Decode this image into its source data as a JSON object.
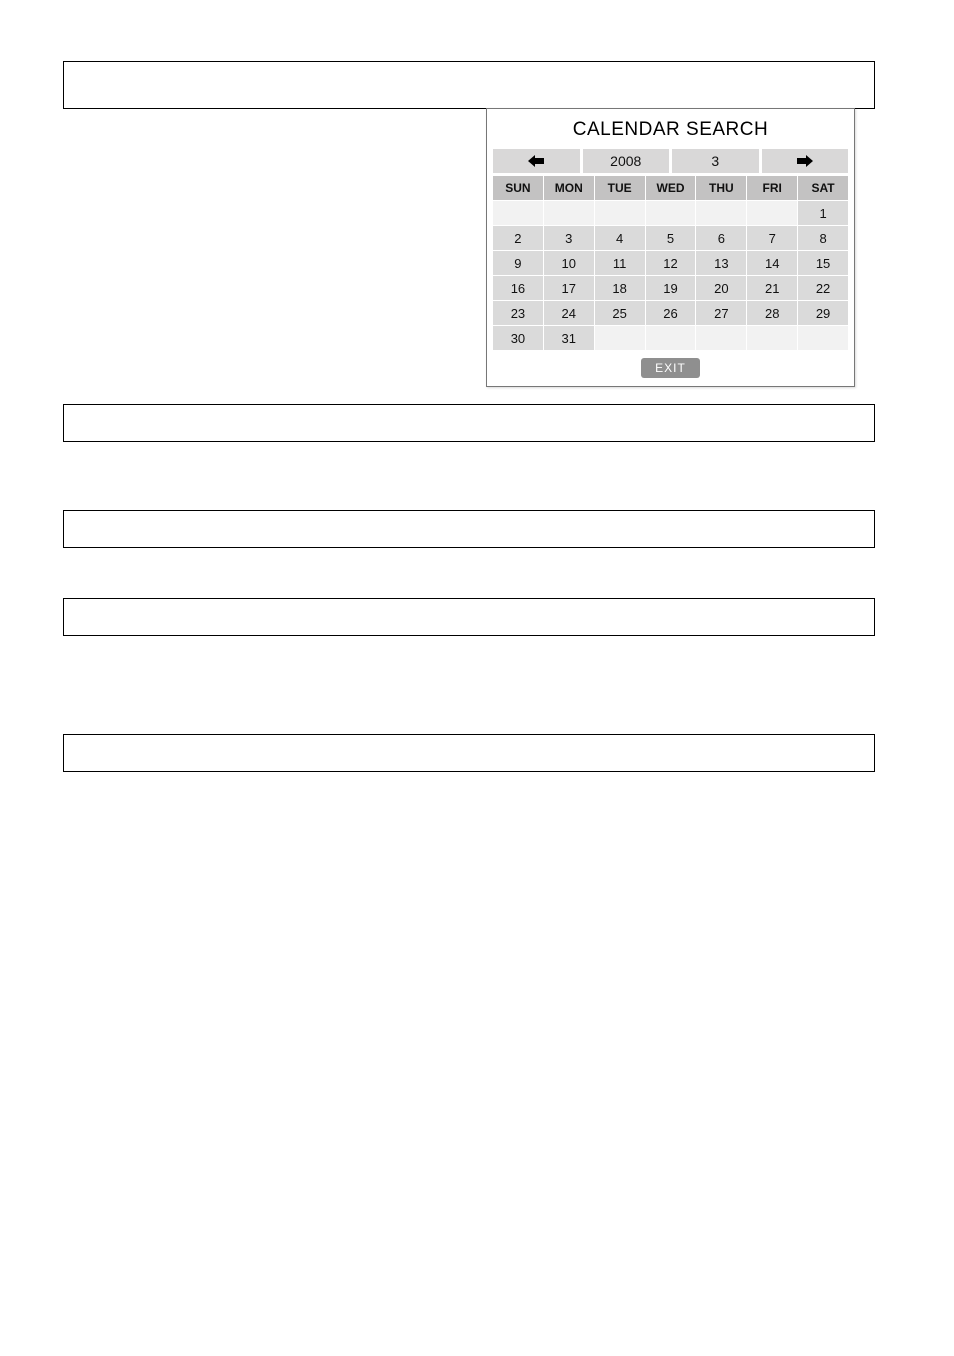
{
  "calendar": {
    "title": "CALENDAR SEARCH",
    "year": "2008",
    "month": "3",
    "dow": [
      "SUN",
      "MON",
      "TUE",
      "WED",
      "THU",
      "FRI",
      "SAT"
    ],
    "leading_blanks": 6,
    "days": [
      "1",
      "2",
      "3",
      "4",
      "5",
      "6",
      "7",
      "8",
      "9",
      "10",
      "11",
      "12",
      "13",
      "14",
      "15",
      "16",
      "17",
      "18",
      "19",
      "20",
      "21",
      "22",
      "23",
      "24",
      "25",
      "26",
      "27",
      "28",
      "29",
      "30",
      "31"
    ],
    "trailing_blanks": 5,
    "exit_label": "EXIT"
  }
}
